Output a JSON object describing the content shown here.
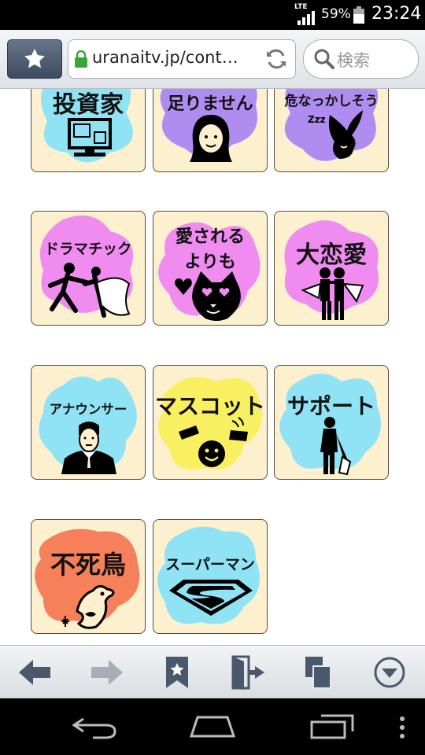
{
  "status_bar": {
    "network": "LTE",
    "battery": "59%",
    "time": "23:24"
  },
  "browser": {
    "url": "uranaitv.jp/cont…",
    "search_placeholder": "検索"
  },
  "tiles": [
    {
      "label": "投資家",
      "color": "#8fe3f5",
      "icon": "computer-icon"
    },
    {
      "label": "足りません",
      "color": "#b08cf0",
      "icon": "woman-face-icon"
    },
    {
      "label": "危なっかしそう",
      "color": "#b08cf0",
      "icon": "sleepy-rabbit-icon"
    },
    {
      "label": "ドラマチック",
      "color": "#f08cf0",
      "icon": "dancing-couple-icon"
    },
    {
      "label_lines": [
        "愛される",
        "よりも"
      ],
      "color": "#f08cf0",
      "icon": "cat-heart-eyes-icon"
    },
    {
      "label": "大恋愛",
      "color": "#f08cf0",
      "icon": "couple-hug-icon"
    },
    {
      "label": "アナウンサー",
      "color": "#8fe3f5",
      "icon": "announcer-icon"
    },
    {
      "label": "マスコット",
      "color": "#f8f060",
      "icon": "smiley-hands-icon"
    },
    {
      "label": "サポート",
      "color": "#8fe3f5",
      "icon": "supporter-icon"
    },
    {
      "label": "不死鳥",
      "color": "#f5805a",
      "icon": "phoenix-icon"
    },
    {
      "label": "スーパーマン",
      "color": "#8fe3f5",
      "icon": "superman-logo-icon"
    }
  ],
  "bottom_nav": [
    "back-icon",
    "forward-icon",
    "bookmark-icon",
    "exit-icon",
    "tabs-icon",
    "menu-icon"
  ],
  "system_nav": [
    "back-icon",
    "home-icon",
    "recents-icon",
    "overflow-icon"
  ]
}
